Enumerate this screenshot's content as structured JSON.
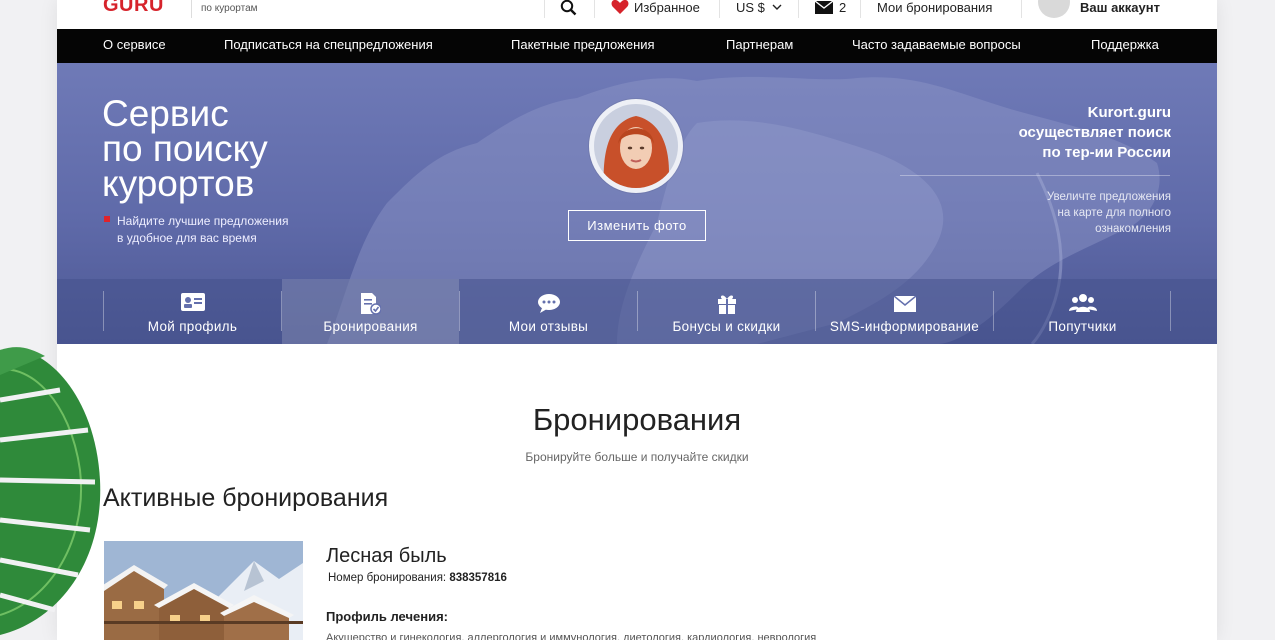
{
  "header": {
    "logo_text": "GURU",
    "logo_sub": "по курортам",
    "favorites_label": "Избранное",
    "currency_label": "US $",
    "messages_count": "2",
    "my_bookings_label": "Мои бронирования",
    "account_label": "Ваш аккаунт"
  },
  "nav": {
    "items": [
      "О сервисе",
      "Подписаться на спецпредложения",
      "Пакетные предложения",
      "Партнерам",
      "Часто задаваемые вопросы",
      "Поддержка"
    ]
  },
  "hero": {
    "title_line1": "Сервис",
    "title_line2": "по поиску",
    "title_line3": "курортов",
    "note_line1": "Найдите лучшие предложения",
    "note_line2": "в удобное для вас время",
    "change_photo_label": "Изменить фото",
    "right_title_line1": "Kurort.guru",
    "right_title_line2": "осуществляет поиск",
    "right_title_line3": "по тер-ии России",
    "right_note_line1": "Увеличте предложения",
    "right_note_line2": "на карте для полного",
    "right_note_line3": "ознакомления"
  },
  "tabs": [
    {
      "label": "Мой профиль",
      "icon": "profile-card-icon"
    },
    {
      "label": "Бронирования",
      "icon": "booking-document-icon"
    },
    {
      "label": "Мои отзывы",
      "icon": "chat-bubbles-icon"
    },
    {
      "label": "Бонусы и скидки",
      "icon": "gift-icon"
    },
    {
      "label": "SMS-информирование",
      "icon": "envelope-icon"
    },
    {
      "label": "Попутчики",
      "icon": "people-icon"
    }
  ],
  "active_tab_index": 1,
  "content": {
    "page_title": "Бронирования",
    "page_subtitle": "Бронируйте больше и получайте скидки",
    "section_title": "Активные бронирования",
    "booking": {
      "name": "Лесная быль",
      "number_label": "Номер бронирования:",
      "number_value": "838357816",
      "profile_label": "Профиль лечения:",
      "profile_list": "Акушерство и гинекология, аллергология и иммунология, диетология, кардиология, неврология"
    }
  },
  "colors": {
    "brand_red": "#d6232b",
    "nav_bg": "#050505",
    "hero_blue": "#6470ad"
  }
}
